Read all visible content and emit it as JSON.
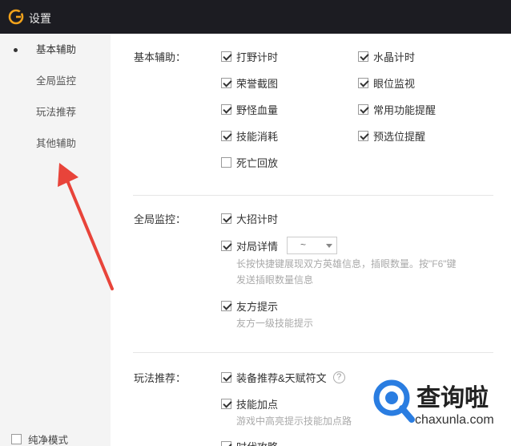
{
  "window": {
    "title": "设置"
  },
  "sidebar": {
    "items": [
      {
        "label": "基本辅助"
      },
      {
        "label": "全局监控"
      },
      {
        "label": "玩法推荐"
      },
      {
        "label": "其他辅助"
      }
    ],
    "pure_mode": {
      "label": "纯净模式",
      "checked": false
    }
  },
  "sections": {
    "basic": {
      "title": "基本辅助：",
      "options": {
        "jungle_timer": {
          "label": "打野计时",
          "checked": true
        },
        "crystal_timer": {
          "label": "水晶计时",
          "checked": true
        },
        "honor_screenshot": {
          "label": "荣誉截图",
          "checked": true
        },
        "ward_monitor": {
          "label": "眼位监视",
          "checked": true
        },
        "monster_health": {
          "label": "野怪血量",
          "checked": true
        },
        "common_reminder": {
          "label": "常用功能提醒",
          "checked": true
        },
        "skill_cost": {
          "label": "技能消耗",
          "checked": true
        },
        "preselect_reminder": {
          "label": "预选位提醒",
          "checked": true
        },
        "death_replay": {
          "label": "死亡回放",
          "checked": false
        }
      }
    },
    "global": {
      "title": "全局监控：",
      "ult_timer": {
        "label": "大招计时",
        "checked": true
      },
      "match_details": {
        "label": "对局详情",
        "checked": true,
        "hotkey_value": "~",
        "desc_line1": "长按快捷键展现双方英雄信息，插眼数量。按\"F6\"键",
        "desc_line2": "发送插眼数量信息"
      },
      "ally_hint": {
        "label": "友方提示",
        "checked": true,
        "desc": "友方一级技能提示"
      }
    },
    "play": {
      "title": "玩法推荐：",
      "equipment": {
        "label": "装备推荐&天赋符文",
        "checked": true,
        "help": "?"
      },
      "skill_points": {
        "label": "技能加点",
        "checked": true,
        "desc": "游戏中高亮提示技能加点路"
      },
      "partial_label": "时代攻略"
    }
  },
  "watermark": {
    "text": "查询啦",
    "sub": "chaxunla.com"
  },
  "colors": {
    "titlebar": "#1c1c22",
    "sidebar": "#f4f4f4",
    "arrow": "#e8443a",
    "logo": "#f2a21b",
    "watermark": "#2a7de1"
  }
}
